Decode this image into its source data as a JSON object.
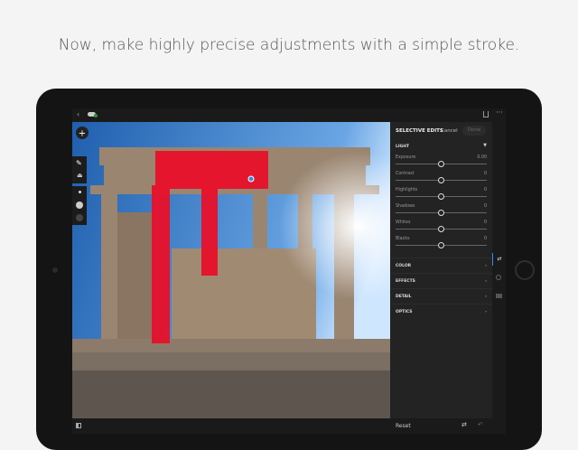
{
  "headline": "Now, make highly precise adjustments with a simple stroke.",
  "panel": {
    "title": "SELECTIVE EDITS",
    "cancel": "Cancel",
    "done": "Done",
    "light": "LIGHT",
    "sliders": [
      {
        "label": "Exposure",
        "value": "0.00",
        "pos": 0.5
      },
      {
        "label": "Contrast",
        "value": "0",
        "pos": 0.5
      },
      {
        "label": "Highlights",
        "value": "0",
        "pos": 0.5
      },
      {
        "label": "Shadows",
        "value": "0",
        "pos": 0.5
      },
      {
        "label": "Whites",
        "value": "0",
        "pos": 0.5
      },
      {
        "label": "Blacks",
        "value": "0",
        "pos": 0.5
      }
    ],
    "groups": [
      "COLOR",
      "EFFECTS",
      "DETAIL",
      "OPTICS"
    ]
  },
  "bottom": {
    "reset": "Reset"
  },
  "colors": {
    "mask": "#e8102a",
    "accent": "#2d8ceb"
  }
}
